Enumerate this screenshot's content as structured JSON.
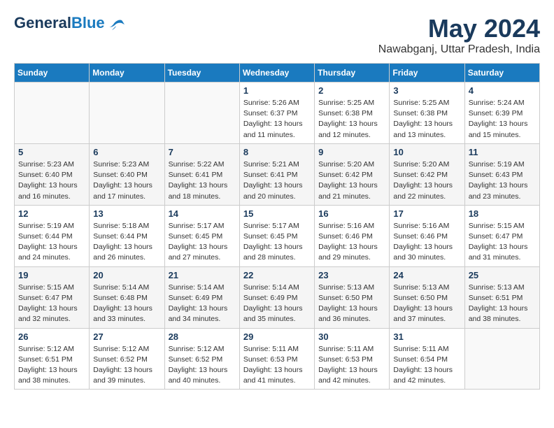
{
  "header": {
    "logo_general": "General",
    "logo_blue": "Blue",
    "main_title": "May 2024",
    "subtitle": "Nawabganj, Uttar Pradesh, India"
  },
  "days_of_week": [
    "Sunday",
    "Monday",
    "Tuesday",
    "Wednesday",
    "Thursday",
    "Friday",
    "Saturday"
  ],
  "weeks": [
    [
      {
        "day": "",
        "info": ""
      },
      {
        "day": "",
        "info": ""
      },
      {
        "day": "",
        "info": ""
      },
      {
        "day": "1",
        "info": "Sunrise: 5:26 AM\nSunset: 6:37 PM\nDaylight: 13 hours\nand 11 minutes."
      },
      {
        "day": "2",
        "info": "Sunrise: 5:25 AM\nSunset: 6:38 PM\nDaylight: 13 hours\nand 12 minutes."
      },
      {
        "day": "3",
        "info": "Sunrise: 5:25 AM\nSunset: 6:38 PM\nDaylight: 13 hours\nand 13 minutes."
      },
      {
        "day": "4",
        "info": "Sunrise: 5:24 AM\nSunset: 6:39 PM\nDaylight: 13 hours\nand 15 minutes."
      }
    ],
    [
      {
        "day": "5",
        "info": "Sunrise: 5:23 AM\nSunset: 6:40 PM\nDaylight: 13 hours\nand 16 minutes."
      },
      {
        "day": "6",
        "info": "Sunrise: 5:23 AM\nSunset: 6:40 PM\nDaylight: 13 hours\nand 17 minutes."
      },
      {
        "day": "7",
        "info": "Sunrise: 5:22 AM\nSunset: 6:41 PM\nDaylight: 13 hours\nand 18 minutes."
      },
      {
        "day": "8",
        "info": "Sunrise: 5:21 AM\nSunset: 6:41 PM\nDaylight: 13 hours\nand 20 minutes."
      },
      {
        "day": "9",
        "info": "Sunrise: 5:20 AM\nSunset: 6:42 PM\nDaylight: 13 hours\nand 21 minutes."
      },
      {
        "day": "10",
        "info": "Sunrise: 5:20 AM\nSunset: 6:42 PM\nDaylight: 13 hours\nand 22 minutes."
      },
      {
        "day": "11",
        "info": "Sunrise: 5:19 AM\nSunset: 6:43 PM\nDaylight: 13 hours\nand 23 minutes."
      }
    ],
    [
      {
        "day": "12",
        "info": "Sunrise: 5:19 AM\nSunset: 6:44 PM\nDaylight: 13 hours\nand 24 minutes."
      },
      {
        "day": "13",
        "info": "Sunrise: 5:18 AM\nSunset: 6:44 PM\nDaylight: 13 hours\nand 26 minutes."
      },
      {
        "day": "14",
        "info": "Sunrise: 5:17 AM\nSunset: 6:45 PM\nDaylight: 13 hours\nand 27 minutes."
      },
      {
        "day": "15",
        "info": "Sunrise: 5:17 AM\nSunset: 6:45 PM\nDaylight: 13 hours\nand 28 minutes."
      },
      {
        "day": "16",
        "info": "Sunrise: 5:16 AM\nSunset: 6:46 PM\nDaylight: 13 hours\nand 29 minutes."
      },
      {
        "day": "17",
        "info": "Sunrise: 5:16 AM\nSunset: 6:46 PM\nDaylight: 13 hours\nand 30 minutes."
      },
      {
        "day": "18",
        "info": "Sunrise: 5:15 AM\nSunset: 6:47 PM\nDaylight: 13 hours\nand 31 minutes."
      }
    ],
    [
      {
        "day": "19",
        "info": "Sunrise: 5:15 AM\nSunset: 6:47 PM\nDaylight: 13 hours\nand 32 minutes."
      },
      {
        "day": "20",
        "info": "Sunrise: 5:14 AM\nSunset: 6:48 PM\nDaylight: 13 hours\nand 33 minutes."
      },
      {
        "day": "21",
        "info": "Sunrise: 5:14 AM\nSunset: 6:49 PM\nDaylight: 13 hours\nand 34 minutes."
      },
      {
        "day": "22",
        "info": "Sunrise: 5:14 AM\nSunset: 6:49 PM\nDaylight: 13 hours\nand 35 minutes."
      },
      {
        "day": "23",
        "info": "Sunrise: 5:13 AM\nSunset: 6:50 PM\nDaylight: 13 hours\nand 36 minutes."
      },
      {
        "day": "24",
        "info": "Sunrise: 5:13 AM\nSunset: 6:50 PM\nDaylight: 13 hours\nand 37 minutes."
      },
      {
        "day": "25",
        "info": "Sunrise: 5:13 AM\nSunset: 6:51 PM\nDaylight: 13 hours\nand 38 minutes."
      }
    ],
    [
      {
        "day": "26",
        "info": "Sunrise: 5:12 AM\nSunset: 6:51 PM\nDaylight: 13 hours\nand 38 minutes."
      },
      {
        "day": "27",
        "info": "Sunrise: 5:12 AM\nSunset: 6:52 PM\nDaylight: 13 hours\nand 39 minutes."
      },
      {
        "day": "28",
        "info": "Sunrise: 5:12 AM\nSunset: 6:52 PM\nDaylight: 13 hours\nand 40 minutes."
      },
      {
        "day": "29",
        "info": "Sunrise: 5:11 AM\nSunset: 6:53 PM\nDaylight: 13 hours\nand 41 minutes."
      },
      {
        "day": "30",
        "info": "Sunrise: 5:11 AM\nSunset: 6:53 PM\nDaylight: 13 hours\nand 42 minutes."
      },
      {
        "day": "31",
        "info": "Sunrise: 5:11 AM\nSunset: 6:54 PM\nDaylight: 13 hours\nand 42 minutes."
      },
      {
        "day": "",
        "info": ""
      }
    ]
  ]
}
